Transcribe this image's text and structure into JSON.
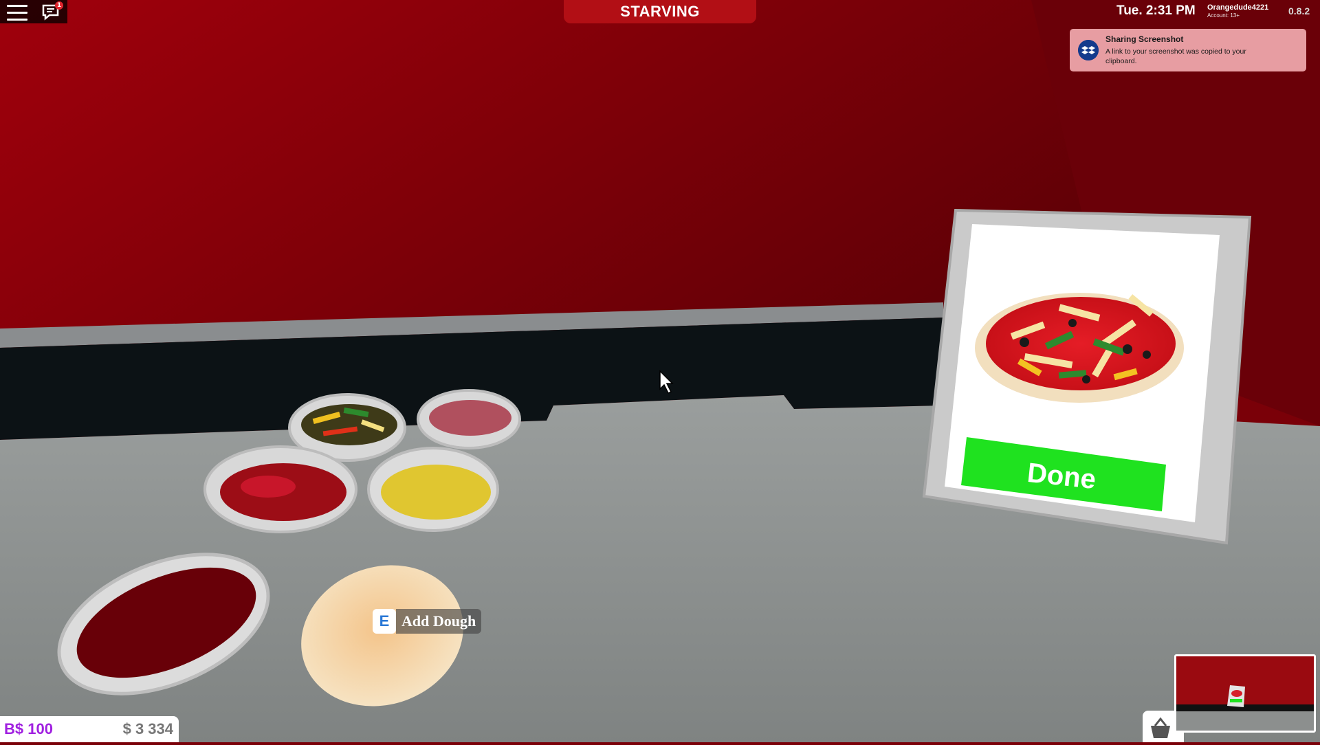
{
  "hud": {
    "status_banner": "STARVING",
    "clock": "Tue. 2:31 PM",
    "username": "Orangedude4221",
    "account": "Account: 13+",
    "version": "0.8.2",
    "chat_badge": "1"
  },
  "toast": {
    "title": "Sharing Screenshot",
    "message": "A link to your screenshot was copied to your clipboard."
  },
  "prompt": {
    "key": "E",
    "action": "Add Dough"
  },
  "order_board": {
    "button_label": "Done"
  },
  "money": {
    "bucks": "B$ 100",
    "cash": "$ 3 334"
  },
  "colors": {
    "wall_red": "#a8000e",
    "counter_gray": "#8b8f8e",
    "done_green": "#1fe21f",
    "bucks_purple": "#a020e0",
    "toast_pink": "#e79da2"
  },
  "icons": {
    "menu": "hamburger-menu-icon",
    "chat": "chat-bubble-icon",
    "toast": "dropbox-icon",
    "shop": "shopping-basket-icon",
    "cursor": "mouse-pointer-icon"
  }
}
